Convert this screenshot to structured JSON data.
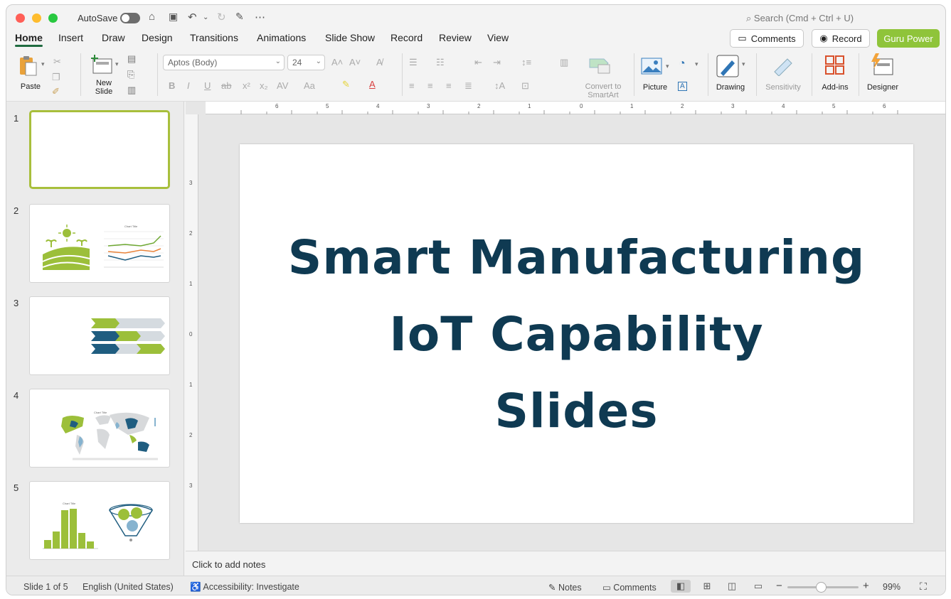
{
  "titlebar": {
    "autosave_label": "AutoSave",
    "search_placeholder": "Search (Cmd + Ctrl + U)"
  },
  "tabs": [
    {
      "label": "Home"
    },
    {
      "label": "Insert"
    },
    {
      "label": "Draw"
    },
    {
      "label": "Design"
    },
    {
      "label": "Transitions"
    },
    {
      "label": "Animations"
    },
    {
      "label": "Slide Show"
    },
    {
      "label": "Record"
    },
    {
      "label": "Review"
    },
    {
      "label": "View"
    }
  ],
  "header_buttons": {
    "comments": "Comments",
    "record": "Record",
    "guru": "Guru Power"
  },
  "ribbon": {
    "paste": "Paste",
    "new_slide_1": "New",
    "new_slide_2": "Slide",
    "font_name": "Aptos (Body)",
    "font_size": "24",
    "convert_1": "Convert to",
    "convert_2": "SmartArt",
    "picture": "Picture",
    "drawing": "Drawing",
    "sensitivity": "Sensitivity",
    "addins": "Add-ins",
    "designer": "Designer"
  },
  "colors": {
    "accent_green": "#8fc43a",
    "title_navy": "#0f3a52",
    "chart_blue": "#1f5d80"
  },
  "slides": [
    {
      "num": "1"
    },
    {
      "num": "2"
    },
    {
      "num": "3"
    },
    {
      "num": "4"
    },
    {
      "num": "5"
    }
  ],
  "thumb_texts": {
    "chart_title": "Chart Title"
  },
  "ruler_h": [
    "6",
    "5",
    "4",
    "3",
    "2",
    "1",
    "0",
    "1",
    "2",
    "3",
    "4",
    "5",
    "6"
  ],
  "ruler_v": [
    "3",
    "2",
    "1",
    "0",
    "1",
    "2",
    "3"
  ],
  "slide": {
    "title_line1": "Smart Manufacturing",
    "title_line2": "IoT Capability",
    "title_line3": "Slides"
  },
  "notes_placeholder": "Click to add notes",
  "status": {
    "slide_info": "Slide 1 of 5",
    "language": "English (United States)",
    "accessibility": "Accessibility: Investigate",
    "notes": "Notes",
    "comments": "Comments",
    "zoom": "99%"
  }
}
